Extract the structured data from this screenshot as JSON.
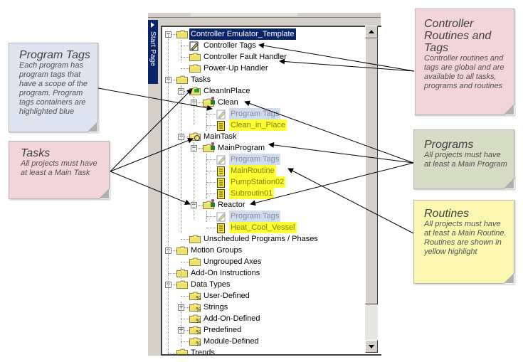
{
  "window": {
    "start_page_label": "Start Page"
  },
  "tree": {
    "items": [
      {
        "label": "Controller Emulator_Template",
        "level": 0,
        "expander": "minus",
        "icon": "folder-open-icon",
        "style": "selected"
      },
      {
        "label": "Controller Tags",
        "level": 1,
        "icon": "tags-pencil-icon",
        "style": "normal"
      },
      {
        "label": "Controller Fault Handler",
        "level": 1,
        "icon": "folder-icon",
        "style": "normal"
      },
      {
        "label": "Power-Up Handler",
        "level": 1,
        "icon": "folder-icon",
        "style": "normal"
      },
      {
        "label": "Tasks",
        "level": 0,
        "expander": "minus",
        "icon": "folder-open-icon",
        "style": "normal"
      },
      {
        "label": "CleanInPlace",
        "level": 1,
        "expander": "minus",
        "icon": "task-event-icon",
        "style": "normal"
      },
      {
        "label": "Clean",
        "level": 2,
        "expander": "minus",
        "icon": "program-folder-icon",
        "style": "normal"
      },
      {
        "label": "Program Tags",
        "level": 3,
        "icon": "tags-pencil-icon",
        "style": "program-tags"
      },
      {
        "label": "Clean_in_Place",
        "level": 3,
        "icon": "routine-icon",
        "style": "routine"
      },
      {
        "label": "MainTask",
        "level": 1,
        "expander": "minus",
        "icon": "task-continuous-icon",
        "style": "normal"
      },
      {
        "label": "MainProgram",
        "level": 2,
        "expander": "minus",
        "icon": "program-folder-icon",
        "style": "normal"
      },
      {
        "label": "Program Tags",
        "level": 3,
        "icon": "tags-pencil-icon",
        "style": "program-tags"
      },
      {
        "label": "MainRoutine",
        "level": 3,
        "icon": "main-routine-icon",
        "style": "routine"
      },
      {
        "label": "PumpStation02",
        "level": 3,
        "icon": "routine-icon",
        "style": "routine"
      },
      {
        "label": "Subroutin01",
        "level": 3,
        "icon": "sfc-routine-icon",
        "style": "routine"
      },
      {
        "label": "Reactor",
        "level": 2,
        "expander": "minus",
        "icon": "program-folder-icon",
        "style": "normal"
      },
      {
        "label": "Program Tags",
        "level": 3,
        "icon": "tags-pencil-icon",
        "style": "program-tags"
      },
      {
        "label": "Heat_Cool_Vessel",
        "level": 3,
        "icon": "routine-icon",
        "style": "routine"
      },
      {
        "label": "Unscheduled Programs / Phases",
        "level": 1,
        "icon": "folder-icon",
        "style": "normal"
      },
      {
        "label": "Motion Groups",
        "level": 0,
        "expander": "minus",
        "icon": "folder-open-icon",
        "style": "normal"
      },
      {
        "label": "Ungrouped Axes",
        "level": 1,
        "icon": "folder-icon",
        "style": "normal"
      },
      {
        "label": "Add-On Instructions",
        "level": 0,
        "icon": "folder-icon",
        "style": "normal"
      },
      {
        "label": "Data Types",
        "level": 0,
        "expander": "minus",
        "icon": "folder-open-icon",
        "style": "normal"
      },
      {
        "label": "User-Defined",
        "level": 1,
        "icon": "datatype-folder-icon",
        "style": "normal"
      },
      {
        "label": "Strings",
        "level": 1,
        "expander": "plus",
        "icon": "datatype-folder-icon",
        "style": "normal"
      },
      {
        "label": "Add-On-Defined",
        "level": 1,
        "icon": "datatype-folder-icon",
        "style": "normal"
      },
      {
        "label": "Predefined",
        "level": 1,
        "expander": "plus",
        "icon": "datatype-folder-icon",
        "style": "normal"
      },
      {
        "label": "Module-Defined",
        "level": 1,
        "icon": "datatype-folder-icon",
        "style": "normal"
      },
      {
        "label": "Trends",
        "level": 0,
        "icon": "folder-icon",
        "style": "normal"
      }
    ]
  },
  "scrollbar": {
    "thumb_start_fraction": 0.0,
    "visible_fraction": 0.86
  },
  "notes": {
    "program_tags": {
      "title": "Program Tags",
      "body": "Each program has program tags that have a scope of the program. Program tags containers are highlighted blue",
      "color": "#dce4f0"
    },
    "tasks": {
      "title": "Tasks",
      "body": "All projects must have at least a Main Task",
      "color": "#f2d5d7"
    },
    "controller": {
      "title": "Controller Routines and Tags",
      "body": "Controller routines and tags are global and are available to all tasks, programs and routines",
      "color": "#f2d5d7"
    },
    "programs": {
      "title": "Programs",
      "body": "All projects must have at least a Main Program",
      "color": "#d7dcc5"
    },
    "routines": {
      "title": "Routines",
      "body": "All projects must have at least a Main Routine. Routines are shown in yellow highlight",
      "color": "#fbf7b0"
    }
  },
  "colors": {
    "selection": "#0a246a",
    "program_tags_highlight": "#d3dcec",
    "routine_highlight": "#ffff33"
  }
}
